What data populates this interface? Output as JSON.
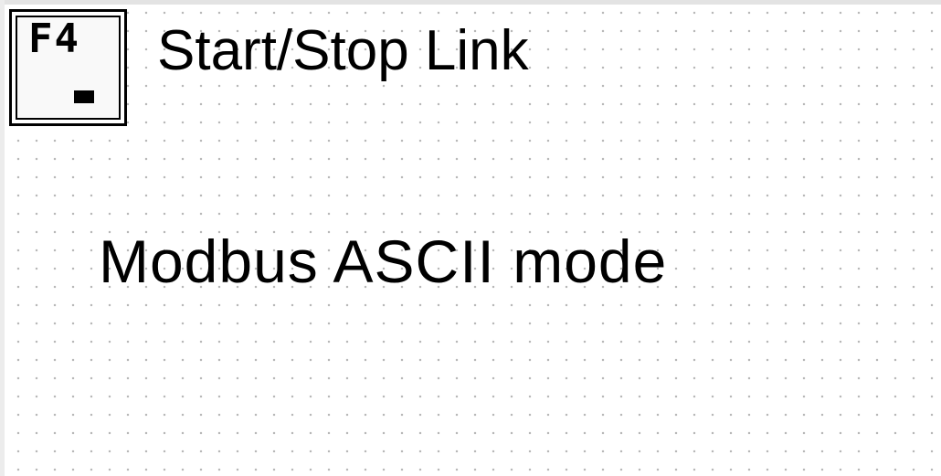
{
  "function_key": {
    "label": "F4",
    "icon": "function-key-icon"
  },
  "link_control": {
    "title": "Start/Stop Link"
  },
  "protocol": {
    "mode_text": "Modbus ASCII mode"
  }
}
